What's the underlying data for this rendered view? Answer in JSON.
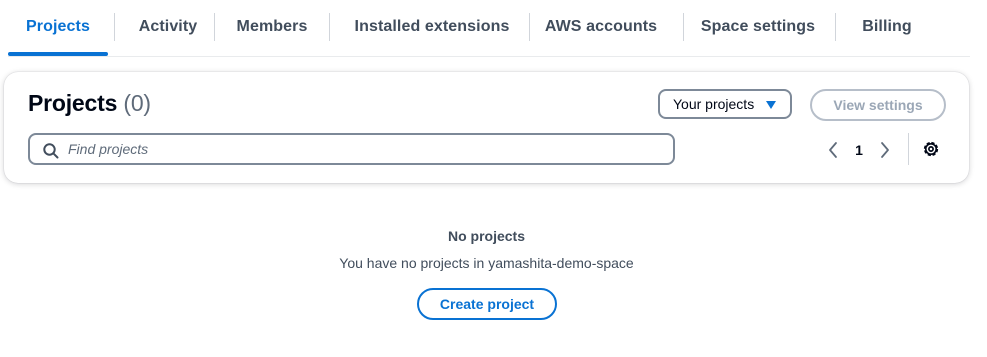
{
  "tabs": [
    {
      "label": "Projects",
      "active": true
    },
    {
      "label": "Activity",
      "active": false
    },
    {
      "label": "Members",
      "active": false
    },
    {
      "label": "Installed extensions",
      "active": false
    },
    {
      "label": "AWS accounts",
      "active": false
    },
    {
      "label": "Space settings",
      "active": false
    },
    {
      "label": "Billing",
      "active": false
    }
  ],
  "card": {
    "title": "Projects",
    "count": "(0)",
    "filter_select": {
      "value": "Your projects",
      "icon": "caret-down-icon"
    },
    "view_settings_label": "View settings",
    "search": {
      "placeholder": "Find projects",
      "value": "",
      "icon": "search-icon"
    },
    "pagination": {
      "current_page": "1",
      "prev_icon": "chevron-left-icon",
      "next_icon": "chevron-right-icon"
    },
    "preferences_icon": "gear-icon"
  },
  "empty_state": {
    "title": "No projects",
    "message": "You have no projects in yamashita-demo-space",
    "button_label": "Create project"
  },
  "colors": {
    "accent": "#0972d3",
    "text_primary": "#000716",
    "text_secondary": "#414d5c",
    "disabled": "#9ba7b6",
    "border": "#7d8998"
  }
}
